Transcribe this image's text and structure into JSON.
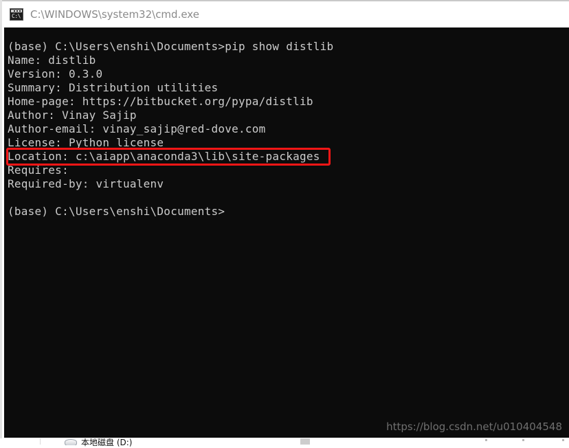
{
  "window": {
    "title": "C:\\WINDOWS\\system32\\cmd.exe",
    "icon": "cmd-icon",
    "icon_glyph": "C:\\"
  },
  "console": {
    "background_color": "#0c0c0c",
    "text_color": "#cccccc",
    "lines": [
      "(base) C:\\Users\\enshi\\Documents>pip show distlib",
      "Name: distlib",
      "Version: 0.3.0",
      "Summary: Distribution utilities",
      "Home-page: https://bitbucket.org/pypa/distlib",
      "Author: Vinay Sajip",
      "Author-email: vinay_sajip@red-dove.com",
      "License: Python license",
      "Location: c:\\aiapp\\anaconda3\\lib\\site-packages",
      "Requires:",
      "Required-by: virtualenv",
      "",
      "(base) C:\\Users\\enshi\\Documents>"
    ],
    "command": "pip show distlib",
    "prompt": "(base) C:\\Users\\enshi\\Documents>",
    "package": {
      "name": "distlib",
      "version": "0.3.0",
      "summary": "Distribution utilities",
      "home_page": "https://bitbucket.org/pypa/distlib",
      "author": "Vinay Sajip",
      "author_email": "vinay_sajip@red-dove.com",
      "license": "Python license",
      "location": "c:\\aiapp\\anaconda3\\lib\\site-packages",
      "requires": "",
      "required_by": "virtualenv"
    }
  },
  "annotation": {
    "highlight_color": "#fb1616",
    "highlighted_line": "Location: c:\\aiapp\\anaconda3\\lib\\site-packages"
  },
  "watermark": {
    "text": "https://blog.csdn.net/u010404548"
  },
  "background_window": {
    "drive_label": "本地磁盘 (D:)"
  }
}
